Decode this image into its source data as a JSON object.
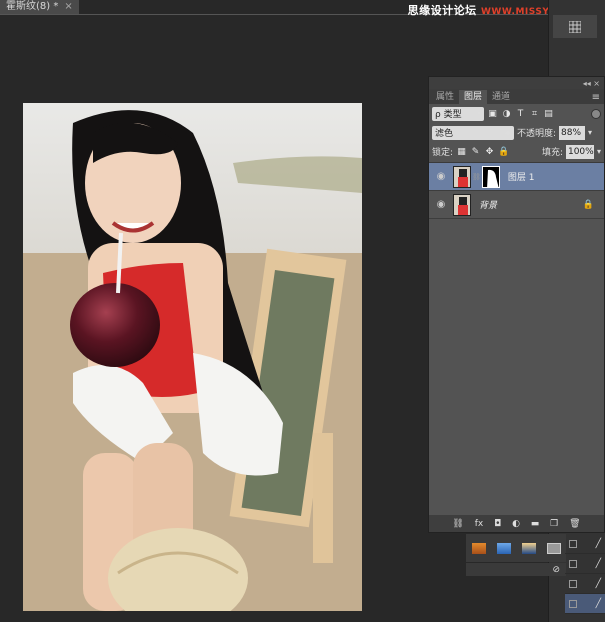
{
  "document": {
    "tab_title": "霍斯纹(8) *",
    "close_glyph": "×"
  },
  "watermark": {
    "text": "思缘设计论坛",
    "url": "WWW.MISSYUAN.COM"
  },
  "layers_panel": {
    "collapse_glyph": "◂◂",
    "close_glyph": "×",
    "tabs": [
      "属性",
      "图层",
      "通道"
    ],
    "active_tab": "图层",
    "menu_glyph": "≡",
    "filter_kind": "ρ 类型",
    "blend_mode": "滤色",
    "opacity_label": "不透明度:",
    "opacity_value": "88%",
    "lock_label": "锁定:",
    "fill_label": "填充:",
    "fill_value": "100%",
    "layers": [
      {
        "name": "图层 1",
        "selected": true,
        "has_mask": true
      },
      {
        "name": "背景",
        "selected": false,
        "locked": true
      }
    ],
    "footer_icons": [
      "link-icon",
      "fx-icon",
      "mask-icon",
      "adjustment-icon",
      "folder-icon",
      "new-layer-icon",
      "trash-icon"
    ],
    "footer_glyphs": [
      "⛓",
      "fx",
      "◘",
      "◐",
      "▬",
      "❐",
      "🗑"
    ]
  },
  "colors": {
    "selection": "#6b7fa3",
    "panel_bg": "#535353",
    "canvas_bg": "#282828"
  }
}
